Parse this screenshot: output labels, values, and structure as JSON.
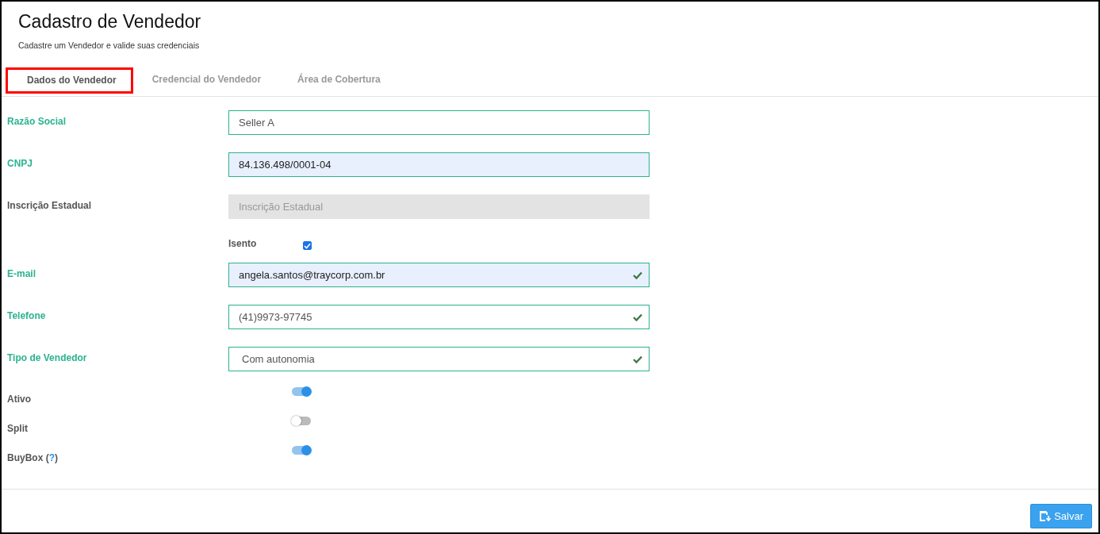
{
  "header": {
    "title": "Cadastro de Vendedor",
    "subtitle": "Cadastre um Vendedor e valide suas credenciais"
  },
  "tabs": [
    {
      "label": "Dados do Vendedor",
      "selected": true,
      "highlighted": true
    },
    {
      "label": "Credencial do Vendedor",
      "selected": false,
      "highlighted": false
    },
    {
      "label": "Área de Cobertura",
      "selected": false,
      "highlighted": false
    }
  ],
  "fields": [
    {
      "kind": "input",
      "label": "Razão Social",
      "value": "Seller A",
      "valid": true,
      "autofilled": false,
      "check": false,
      "disabled": false
    },
    {
      "kind": "input",
      "label": "CNPJ",
      "value": "84.136.498/0001-04",
      "valid": true,
      "autofilled": true,
      "check": false,
      "disabled": false
    },
    {
      "kind": "input",
      "label": "Inscrição Estadual",
      "placeholder": "Inscrição Estadual",
      "valid": false,
      "autofilled": false,
      "check": false,
      "disabled": true
    },
    {
      "kind": "checkbox",
      "label": "Isento",
      "checked": true
    },
    {
      "kind": "input",
      "label": "E-mail",
      "value": "angela.santos@traycorp.com.br",
      "valid": true,
      "autofilled": true,
      "check": true,
      "disabled": false
    },
    {
      "kind": "input",
      "label": "Telefone",
      "value": "(41)9973-97745",
      "valid": true,
      "autofilled": false,
      "check": true,
      "disabled": false
    },
    {
      "kind": "select",
      "label": "Tipo de Vendedor",
      "value": "Com autonomia",
      "valid": true,
      "check": true
    },
    {
      "kind": "toggle",
      "label": "Ativo",
      "on": true
    },
    {
      "kind": "toggle",
      "label": "Split",
      "on": false
    },
    {
      "kind": "toggle",
      "label": "BuyBox (",
      "help": "?",
      "label_end": ")",
      "on": true
    }
  ],
  "save_button": {
    "label": "Salvar"
  }
}
